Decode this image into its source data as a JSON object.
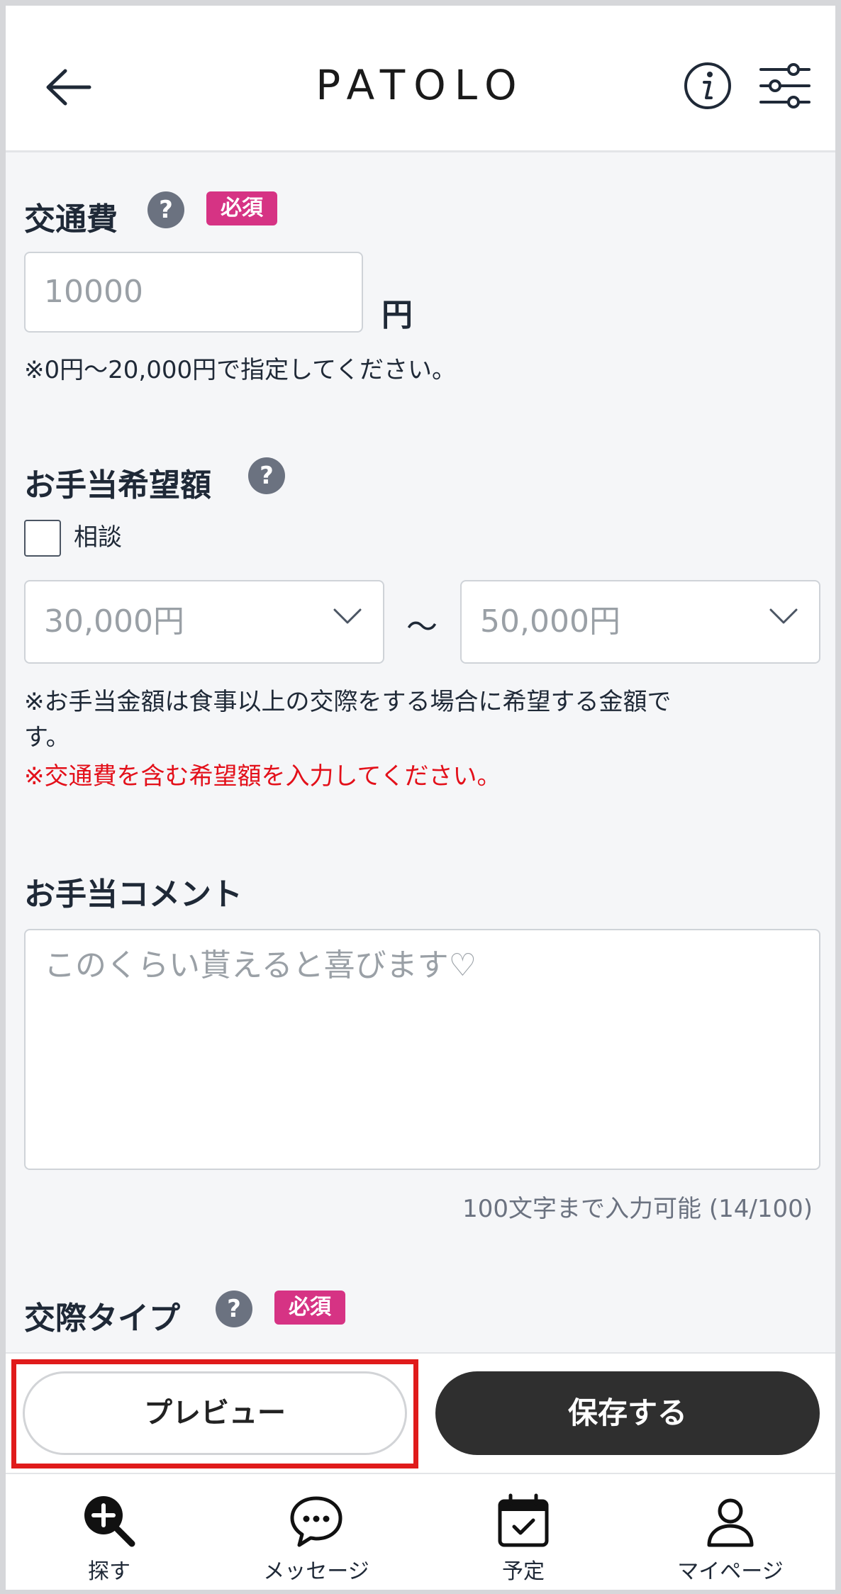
{
  "header": {
    "logo": "PATOLO",
    "back_icon": "arrow-left-icon",
    "info_icon": "info-circle-icon",
    "filter_icon": "sliders-icon"
  },
  "transport": {
    "title": "交通費",
    "help": "?",
    "required": "必須",
    "value": "10000",
    "unit": "円",
    "note": "※0円〜20,000円で指定してください。"
  },
  "allowance": {
    "title": "お手当希望額",
    "help": "?",
    "consult_label": "相談",
    "consult_checked": false,
    "min_value": "30,000円",
    "separator": "〜",
    "max_value": "50,000円",
    "note_line1": "※お手当金額は食事以上の交際をする場合に希望する金額で",
    "note_line2": "す。",
    "warning": "※交通費を含む希望額を入力してください。"
  },
  "comment": {
    "title": "お手当コメント",
    "placeholder": "このくらい貰えると喜びます♡",
    "counter": "100文字まで入力可能 (14/100)"
  },
  "relation_type": {
    "title": "交際タイプ",
    "help": "?",
    "required": "必須"
  },
  "actions": {
    "preview_label": "プレビュー",
    "save_label": "保存する"
  },
  "nav": [
    {
      "label": "探す",
      "icon": "search-plus-icon"
    },
    {
      "label": "メッセージ",
      "icon": "chat-bubble-icon"
    },
    {
      "label": "予定",
      "icon": "calendar-check-icon"
    },
    {
      "label": "マイページ",
      "icon": "user-icon"
    }
  ],
  "colors": {
    "required_badge": "#d63384",
    "warning_text": "#e3101a",
    "save_button": "#2f2f2f",
    "highlight_border": "#e01b1b"
  }
}
